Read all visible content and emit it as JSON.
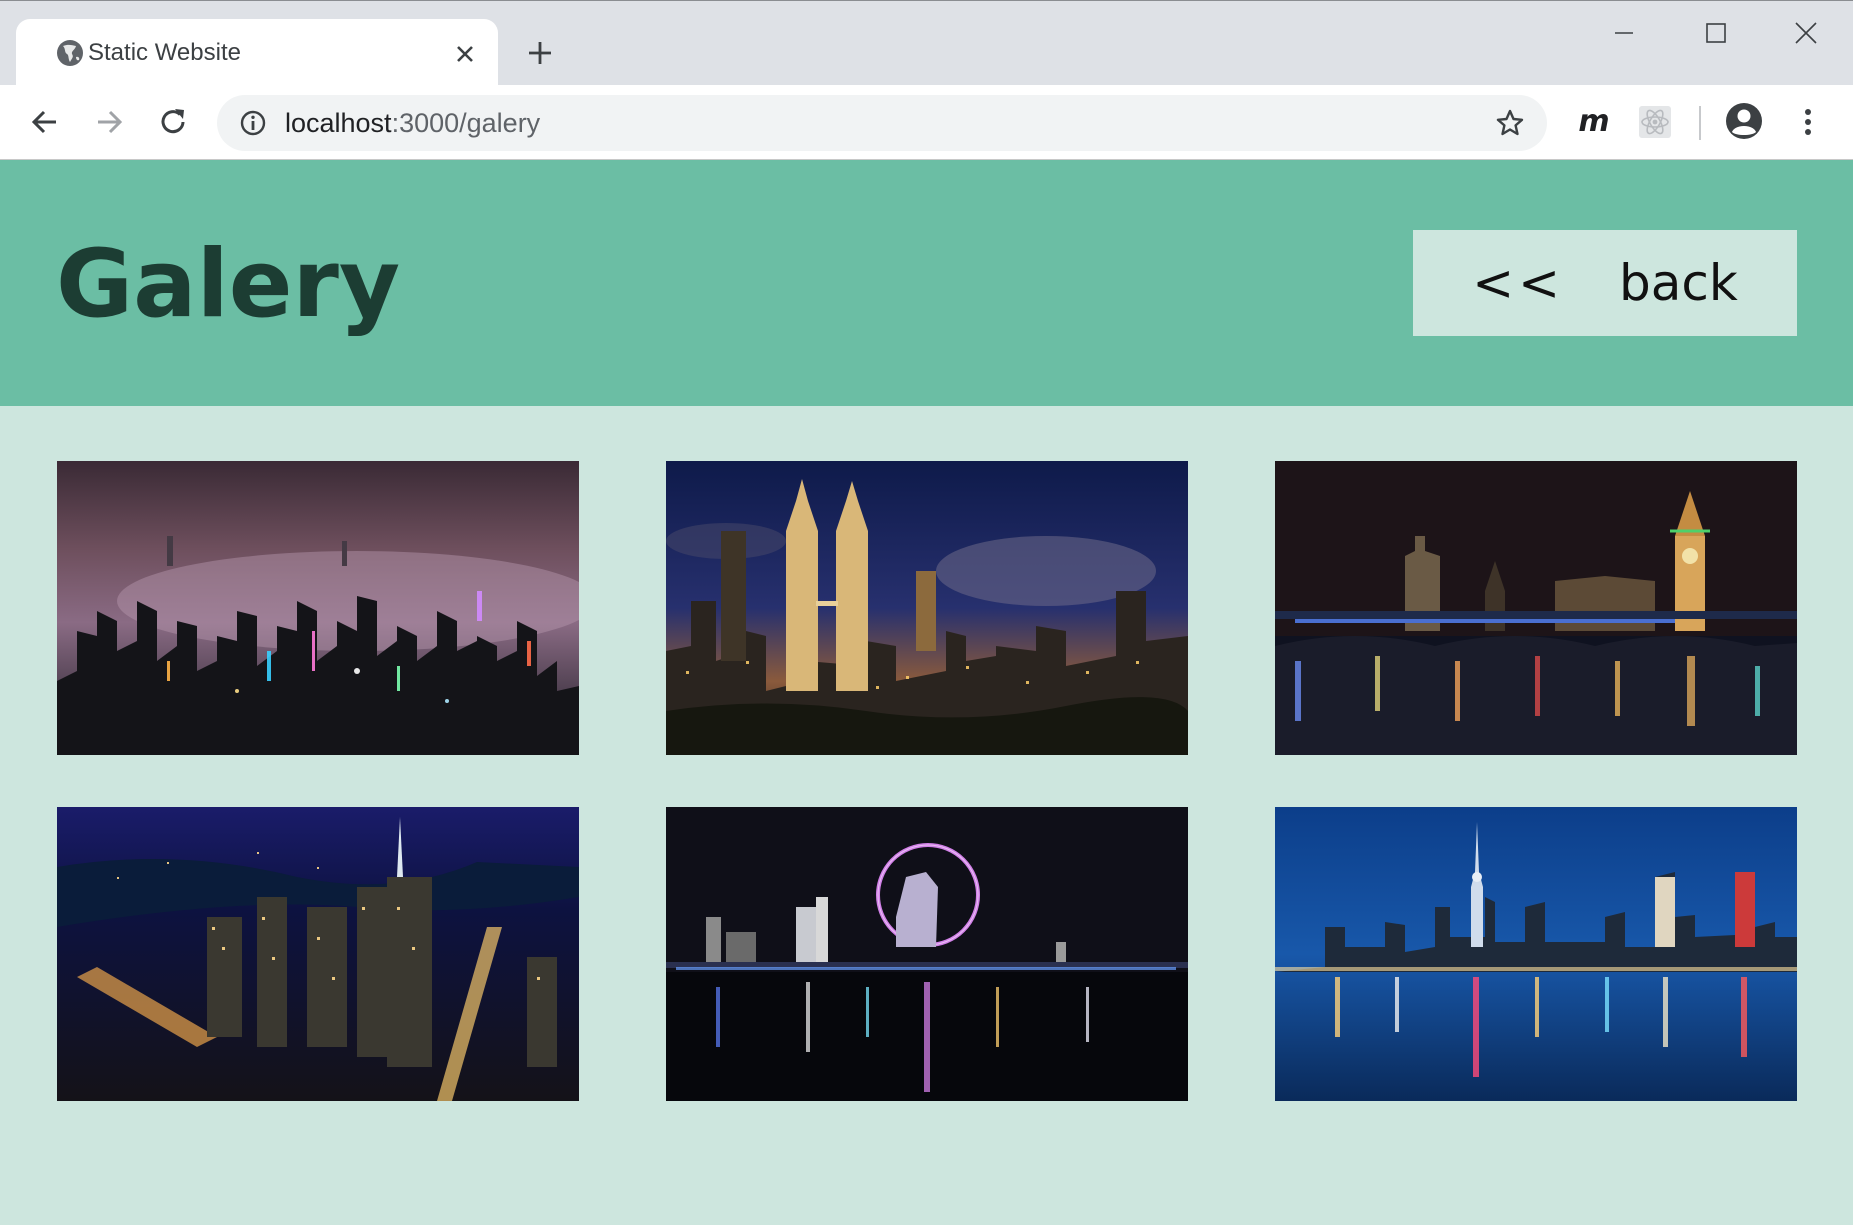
{
  "browser": {
    "tab": {
      "title": "Static Website"
    },
    "address_bar": {
      "host": "localhost",
      "rest": ":3000/galery"
    },
    "extensions": {
      "m_label": "m"
    }
  },
  "page": {
    "header": {
      "title": "Galery",
      "back_button": {
        "arrows": "<<",
        "label": "back"
      }
    },
    "colors": {
      "header_bg": "#6bbea4",
      "page_bg": "#cde6de",
      "title_text": "#1c3d33"
    },
    "gallery": [
      {
        "name": "photo-foggy-city-night",
        "scene": "foggy skyline at night"
      },
      {
        "name": "photo-twin-towers-night",
        "scene": "twin towers skyline at night"
      },
      {
        "name": "photo-parliament-big-ben",
        "scene": "parliament and clock tower over river"
      },
      {
        "name": "photo-aerial-city-night",
        "scene": "aerial city view at night"
      },
      {
        "name": "photo-ferris-wheel-night",
        "scene": "ferris wheel reflected on water"
      },
      {
        "name": "photo-tower-skyline-reflection",
        "scene": "skyline with tall tower reflected on lake"
      }
    ]
  }
}
